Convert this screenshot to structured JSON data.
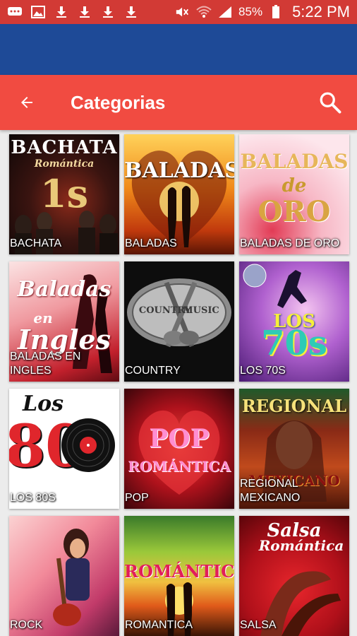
{
  "status_bar": {
    "battery": "85%",
    "time": "5:22 PM",
    "icons": [
      "chat-icon",
      "image-icon",
      "download-icon",
      "download-icon",
      "download-icon",
      "download-icon",
      "mute-icon",
      "wifi-icon",
      "signal-icon",
      "battery-icon"
    ]
  },
  "app_bar": {
    "title": "Categorias",
    "back_icon": "back-arrow-icon",
    "search_icon": "search-icon",
    "color": "#f14b41"
  },
  "colors": {
    "status_bar": "#d23a35",
    "blue_band": "#1e4a97",
    "background": "#ececec"
  },
  "categories": [
    {
      "label": "BACHATA",
      "art_text": [
        "BACHATA",
        "Romántica",
        "1s"
      ]
    },
    {
      "label": "BALADAS",
      "art_text": [
        "BALADAS"
      ]
    },
    {
      "label": "BALADAS DE ORO",
      "art_text": [
        "BALADAS",
        "de",
        "ORO"
      ]
    },
    {
      "label": "BALADAS EN INGLES",
      "art_text": [
        "Baladas",
        "en",
        "Ingles"
      ]
    },
    {
      "label": "COUNTRY",
      "art_text": [
        "COUNTRY",
        "MUSIC"
      ]
    },
    {
      "label": "LOS 70S",
      "art_text": [
        "LOS",
        "70s"
      ]
    },
    {
      "label": "LOS 80S",
      "art_text": [
        "Los",
        "80"
      ]
    },
    {
      "label": "POP",
      "art_text": [
        "POP",
        "ROMÁNTICA"
      ]
    },
    {
      "label": "REGIONAL MEXICANO",
      "art_text": [
        "REGIONAL",
        "MEXICANO"
      ]
    },
    {
      "label": "ROCK",
      "art_text": []
    },
    {
      "label": "ROMANTICA",
      "art_text": [
        "ROMÁNTICA"
      ]
    },
    {
      "label": "SALSA",
      "art_text": [
        "Salsa",
        "Romántica"
      ]
    }
  ]
}
